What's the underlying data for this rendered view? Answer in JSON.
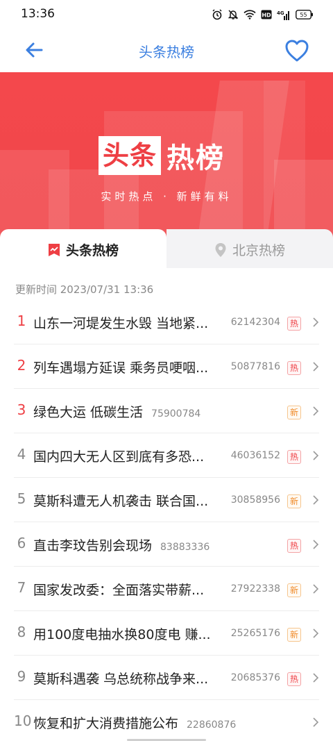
{
  "status": {
    "time": "13:36",
    "battery": "55"
  },
  "nav": {
    "title": "头条热榜"
  },
  "banner": {
    "logo_box": "头条",
    "logo_text": "热榜",
    "slogan": "实时热点 · 新鲜有料"
  },
  "tabs": [
    {
      "label": "头条热榜",
      "active": true
    },
    {
      "label": "北京热榜",
      "active": false
    }
  ],
  "update_time": "更新时间 2023/07/31 13:36",
  "items": [
    {
      "rank": "1",
      "title": "山东一河堤发生水毁 当地紧...",
      "hot": "62142304",
      "badge": "热",
      "badge_type": "hot"
    },
    {
      "rank": "2",
      "title": "列车遇塌方延误 乘务员哽咽...",
      "hot": "50877816",
      "badge": "热",
      "badge_type": "hot"
    },
    {
      "rank": "3",
      "title": "绿色大运 低碳生活",
      "hot": "75900784",
      "badge": "新",
      "badge_type": "new",
      "inline": true
    },
    {
      "rank": "4",
      "title": "国内四大无人区到底有多恐...",
      "hot": "46036152",
      "badge": "热",
      "badge_type": "hot"
    },
    {
      "rank": "5",
      "title": "莫斯科遭无人机袭击 联合国...",
      "hot": "30858956",
      "badge": "新",
      "badge_type": "new"
    },
    {
      "rank": "6",
      "title": "直击李玟告别会现场",
      "hot": "83883336",
      "badge": "热",
      "badge_type": "hot",
      "inline": true
    },
    {
      "rank": "7",
      "title": "国家发改委：全面落实带薪...",
      "hot": "27922338",
      "badge": "新",
      "badge_type": "new"
    },
    {
      "rank": "8",
      "title": "用100度电抽水换80度电 赚...",
      "hot": "25265176",
      "badge": "新",
      "badge_type": "new"
    },
    {
      "rank": "9",
      "title": "莫斯科遇袭 乌总统称战争来...",
      "hot": "20685376",
      "badge": "热",
      "badge_type": "hot"
    },
    {
      "rank": "10",
      "title": "恢复和扩大消费措施公布",
      "hot": "22860876",
      "badge": "",
      "badge_type": "none",
      "inline": true
    }
  ],
  "colors": {
    "accent_blue": "#3b7fe0",
    "brand_red": "#ee3f44",
    "new_orange": "#f08a28"
  }
}
